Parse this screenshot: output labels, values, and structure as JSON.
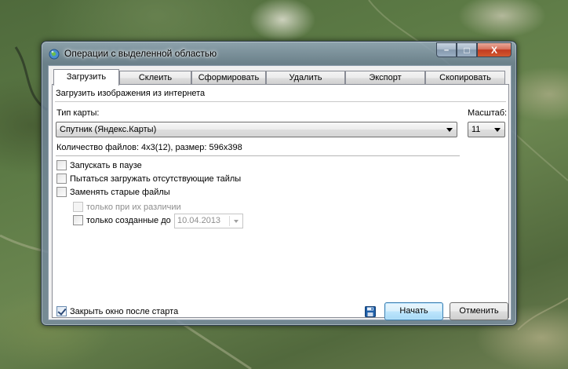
{
  "window": {
    "title": "Операции с выделенной областью",
    "caption": {
      "minimize": "–",
      "maximize": "□",
      "close": "X"
    }
  },
  "tabs": [
    {
      "label": "Загрузить",
      "active": true
    },
    {
      "label": "Склеить",
      "active": false
    },
    {
      "label": "Сформировать",
      "active": false
    },
    {
      "label": "Удалить",
      "active": false
    },
    {
      "label": "Экспорт",
      "active": false
    },
    {
      "label": "Скопировать",
      "active": false
    }
  ],
  "download_tab": {
    "header": "Загрузить изображения из интернета",
    "map_type_label": "Тип карты:",
    "map_type_value": "Спутник (Яндекс.Карты)",
    "scale_label": "Масштаб:",
    "scale_value": "11",
    "file_info": "Количество файлов: 4x3(12), размер: 596x398",
    "options": {
      "start_paused": {
        "label": "Запускать в паузе",
        "checked": false
      },
      "load_missing": {
        "label": "Пытаться загружать отсутствующие тайлы",
        "checked": false
      },
      "replace_old": {
        "label": "Заменять старые файлы",
        "checked": false
      },
      "only_different": {
        "label": "только при их различии",
        "checked": false,
        "enabled": false
      },
      "only_created_before": {
        "label": "только созданные до",
        "checked": false,
        "date": "10.04.2013"
      }
    },
    "close_after_start": {
      "label": "Закрыть окно после старта",
      "checked": true
    }
  },
  "buttons": {
    "start": "Начать",
    "cancel": "Отменить"
  },
  "colors": {
    "window_frame": "#8aa2b8",
    "close_button": "#c23b20",
    "default_button_border": "#3c7fb1",
    "save_icon": "#1f5fa8"
  }
}
